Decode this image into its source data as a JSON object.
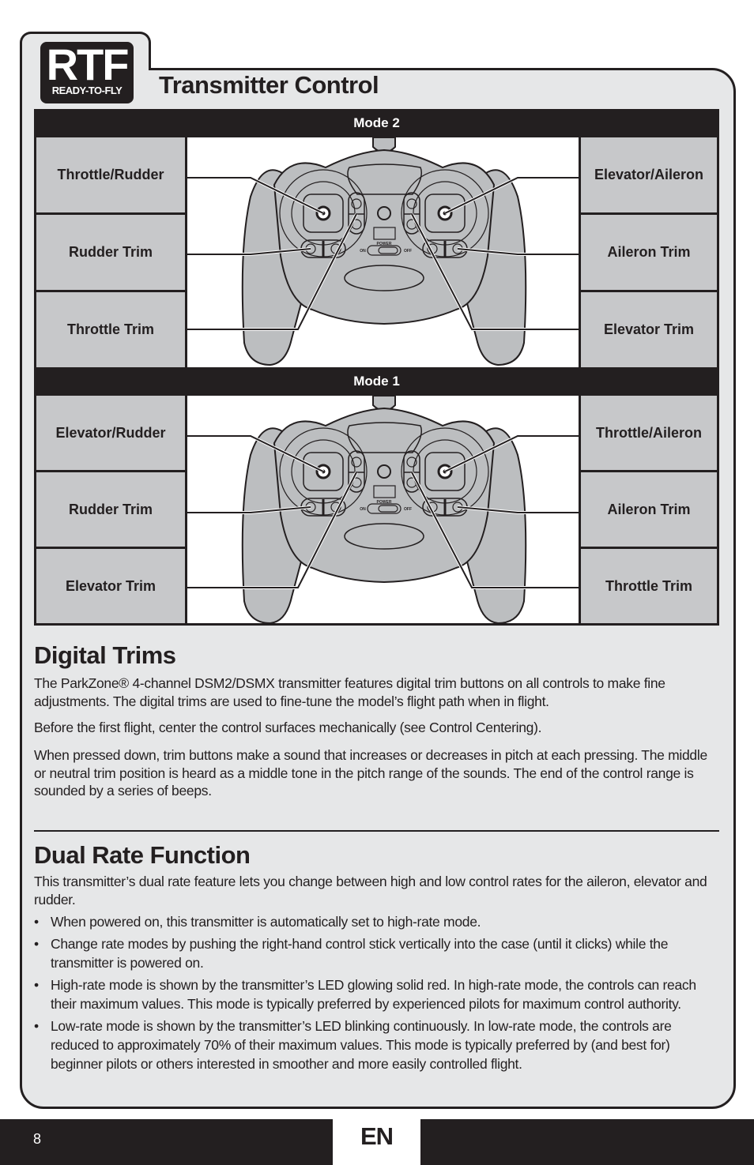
{
  "header": {
    "logo": {
      "big": "RTF",
      "small": "READY-TO-FLY"
    },
    "title": "Transmitter Control"
  },
  "modes": [
    {
      "label": "Mode 2",
      "left": [
        "Throttle/Rudder",
        "Rudder Trim",
        "Throttle Trim"
      ],
      "right": [
        "Elevator/Aileron",
        "Aileron Trim",
        "Elevator Trim"
      ]
    },
    {
      "label": "Mode 1",
      "left": [
        "Elevator/Rudder",
        "Rudder Trim",
        "Elevator Trim"
      ],
      "right": [
        "Throttle/Aileron",
        "Aileron Trim",
        "Throttle Trim"
      ]
    }
  ],
  "transmitter": {
    "power_label": "POWER",
    "on_label": "ON",
    "off_label": "OFF"
  },
  "digital_trims": {
    "heading": "Digital Trims",
    "paragraphs": [
      "The ParkZone® 4-channel DSM2/DSMX transmitter features digital trim buttons on all controls to make fine adjustments. The digital trims are used to fine-tune the model’s flight path when in flight.",
      "Before the first flight, center the control surfaces mechanically (see Control Centering).",
      "When pressed down, trim buttons make a sound that increases or decreases in pitch at each pressing. The middle or neutral trim position is heard as a middle tone in the pitch range of the sounds. The end of the control range is sounded by a series of beeps."
    ]
  },
  "dual_rate": {
    "heading": "Dual Rate Function",
    "intro": "This transmitter’s dual rate feature lets you change between high and low control rates for the aileron, elevator and rudder.",
    "bullet_glyph": "•",
    "bullets": [
      "When powered on, this transmitter is automatically set to high-rate mode.",
      "Change rate modes by pushing the right-hand control stick vertically into the case (until it clicks) while the transmitter is powered on.",
      "High-rate mode is shown by the transmitter’s LED glowing solid red. In high-rate mode, the controls can reach their maximum values. This mode is typically preferred by experienced pilots for maximum control authority.",
      "Low-rate mode is shown by the transmitter’s LED blinking continuously. In low-rate mode, the controls are reduced to approximately 70% of their maximum values. This mode is typically preferred by (and best for) beginner pilots or others interested in smoother and more easily controlled flight."
    ]
  },
  "footer": {
    "page_number": "8",
    "language": "EN"
  },
  "colors": {
    "ink": "#231f20",
    "panel": "#e6e7e8",
    "cell": "#c7c8ca",
    "device": "#bcbec0"
  }
}
